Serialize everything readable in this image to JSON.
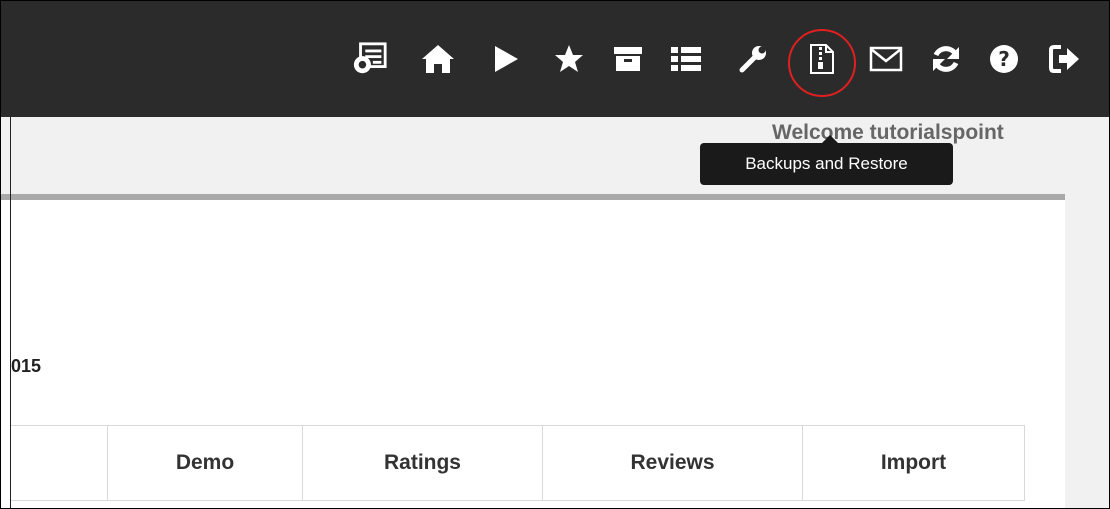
{
  "toolbar": {
    "icons": [
      "dashboard-settings-icon",
      "home-icon",
      "play-icon",
      "star-icon",
      "archive-icon",
      "list-icon",
      "wrench-icon",
      "backup-zip-icon",
      "envelope-icon",
      "refresh-icon",
      "help-icon",
      "logout-icon"
    ],
    "highlight_color": "#e02020"
  },
  "header": {
    "welcome_text": "Welcome tutorialspoint"
  },
  "tooltip": {
    "text": "Backups and Restore"
  },
  "main": {
    "year_fragment": "015",
    "tabs": [
      {
        "label": ""
      },
      {
        "label": "Demo"
      },
      {
        "label": "Ratings"
      },
      {
        "label": "Reviews"
      },
      {
        "label": "Import"
      }
    ]
  },
  "colors": {
    "topbar": "#2b2b2b",
    "tooltip_bg": "#1a1a1a",
    "panel_border": "#a9a9a9"
  }
}
